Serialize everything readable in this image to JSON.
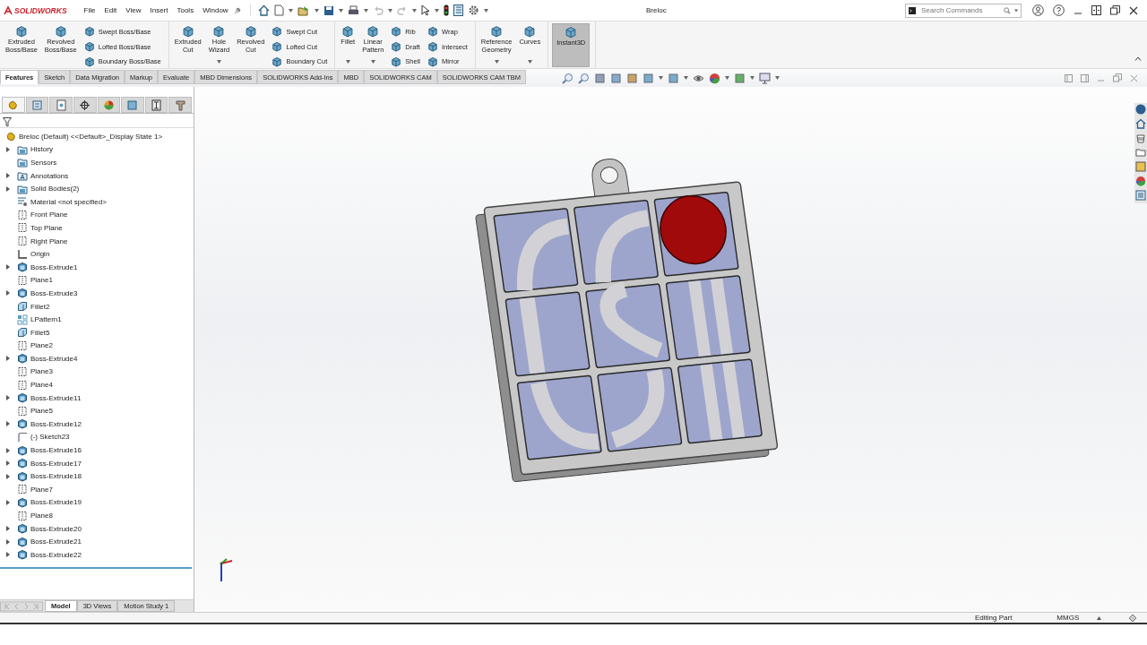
{
  "window": {
    "app": "SOLIDWORKS",
    "title": "Breloc"
  },
  "menu": [
    "File",
    "Edit",
    "View",
    "Insert",
    "Tools",
    "Window"
  ],
  "search": {
    "placeholder": "Search Commands"
  },
  "command_groups": [
    {
      "columns": [
        {
          "kind": "large",
          "label": "Extruded\nBoss/Base",
          "dropdown": false,
          "selected": false
        },
        {
          "kind": "large",
          "label": "Revolved\nBoss/Base",
          "dropdown": false,
          "selected": false
        },
        {
          "kind": "stack",
          "items": [
            "Swept Boss/Base",
            "Lofted Boss/Base",
            "Boundary Boss/Base"
          ]
        }
      ]
    },
    {
      "columns": [
        {
          "kind": "large",
          "label": "Extruded\nCut",
          "dropdown": false,
          "selected": false
        },
        {
          "kind": "large",
          "label": "Hole\nWizard",
          "dropdown": true,
          "selected": false
        },
        {
          "kind": "large",
          "label": "Revolved\nCut",
          "dropdown": false,
          "selected": false
        },
        {
          "kind": "stack",
          "items": [
            "Swept Cut",
            "Lofted Cut",
            "Boundary Cut"
          ]
        }
      ]
    },
    {
      "columns": [
        {
          "kind": "large",
          "label": "Fillet",
          "dropdown": true,
          "selected": false
        },
        {
          "kind": "large",
          "label": "Linear\nPattern",
          "dropdown": true,
          "selected": false
        },
        {
          "kind": "stack",
          "items": [
            "Rib",
            "Draft",
            "Shell"
          ]
        },
        {
          "kind": "stack",
          "items": [
            "Wrap",
            "Intersect",
            "Mirror"
          ]
        }
      ]
    },
    {
      "columns": [
        {
          "kind": "large",
          "label": "Reference\nGeometry",
          "dropdown": true,
          "selected": false
        },
        {
          "kind": "large",
          "label": "Curves",
          "dropdown": true,
          "selected": false
        }
      ]
    },
    {
      "columns": [
        {
          "kind": "large",
          "label": "Instant3D",
          "dropdown": false,
          "selected": true
        }
      ]
    }
  ],
  "tabs": [
    {
      "label": "Features",
      "selected": true
    },
    {
      "label": "Sketch",
      "selected": false
    },
    {
      "label": "Data Migration",
      "selected": false
    },
    {
      "label": "Markup",
      "selected": false
    },
    {
      "label": "Evaluate",
      "selected": false
    },
    {
      "label": "MBD Dimensions",
      "selected": false
    },
    {
      "label": "SOLIDWORKS Add-Ins",
      "selected": false
    },
    {
      "label": "MBD",
      "selected": false
    },
    {
      "label": "SOLIDWORKS CAM",
      "selected": false
    },
    {
      "label": "SOLIDWORKS CAM TBM",
      "selected": false
    }
  ],
  "feature_tree": {
    "root": "Breloc (Default) <<Default>_Display State 1>",
    "children": [
      {
        "label": "History",
        "kind": "folder",
        "expandable": true
      },
      {
        "label": "Sensors",
        "kind": "folder",
        "expandable": false
      },
      {
        "label": "Annotations",
        "kind": "annotations",
        "expandable": true
      },
      {
        "label": "Solid Bodies(2)",
        "kind": "folder",
        "expandable": true
      },
      {
        "label": "Material <not specified>",
        "kind": "material",
        "expandable": false
      },
      {
        "label": "Front Plane",
        "kind": "plane",
        "expandable": false
      },
      {
        "label": "Top Plane",
        "kind": "plane",
        "expandable": false
      },
      {
        "label": "Right Plane",
        "kind": "plane",
        "expandable": false
      },
      {
        "label": "Origin",
        "kind": "origin",
        "expandable": false
      },
      {
        "label": "Boss-Extrude1",
        "kind": "extrude",
        "expandable": true
      },
      {
        "label": "Plane1",
        "kind": "plane",
        "expandable": false
      },
      {
        "label": "Boss-Extrude3",
        "kind": "extrude",
        "expandable": true
      },
      {
        "label": "Fillet2",
        "kind": "fillet",
        "expandable": false
      },
      {
        "label": "LPattern1",
        "kind": "pattern",
        "expandable": false
      },
      {
        "label": "Fillet5",
        "kind": "fillet",
        "expandable": false
      },
      {
        "label": "Plane2",
        "kind": "plane",
        "expandable": false
      },
      {
        "label": "Boss-Extrude4",
        "kind": "extrude",
        "expandable": true
      },
      {
        "label": "Plane3",
        "kind": "plane",
        "expandable": false
      },
      {
        "label": "Plane4",
        "kind": "plane",
        "expandable": false
      },
      {
        "label": "Boss-Extrude11",
        "kind": "extrude",
        "expandable": true
      },
      {
        "label": "Plane5",
        "kind": "plane",
        "expandable": false
      },
      {
        "label": "Boss-Extrude12",
        "kind": "extrude",
        "expandable": true
      },
      {
        "label": "(-) Sketch23",
        "kind": "sketch",
        "expandable": false
      },
      {
        "label": "Boss-Extrude16",
        "kind": "extrude",
        "expandable": true
      },
      {
        "label": "Boss-Extrude17",
        "kind": "extrude",
        "expandable": true
      },
      {
        "label": "Boss-Extrude18",
        "kind": "extrude",
        "expandable": true
      },
      {
        "label": "Plane7",
        "kind": "plane",
        "expandable": false
      },
      {
        "label": "Boss-Extrude19",
        "kind": "extrude",
        "expandable": true
      },
      {
        "label": "Plane8",
        "kind": "plane",
        "expandable": false
      },
      {
        "label": "Boss-Extrude20",
        "kind": "extrude",
        "expandable": true
      },
      {
        "label": "Boss-Extrude21",
        "kind": "extrude",
        "expandable": true
      },
      {
        "label": "Boss-Extrude22",
        "kind": "extrude",
        "expandable": true
      }
    ]
  },
  "bottom_tabs": [
    {
      "label": "Model",
      "selected": true
    },
    {
      "label": "3D Views",
      "selected": false
    },
    {
      "label": "Motion Study 1",
      "selected": false
    }
  ],
  "status_bar": {
    "message": "Editing Part",
    "units": "MMGS"
  }
}
